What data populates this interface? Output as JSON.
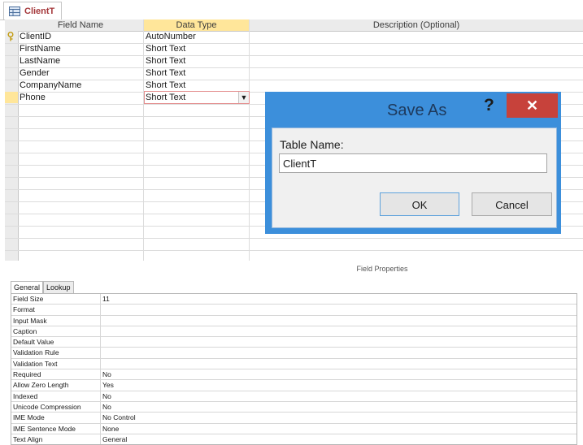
{
  "doc_tab": {
    "label": "ClientT"
  },
  "table": {
    "headers": [
      "Field Name",
      "Data Type",
      "Description (Optional)"
    ],
    "rows": [
      {
        "field": "ClientID",
        "type": "AutoNumber"
      },
      {
        "field": "FirstName",
        "type": "Short Text"
      },
      {
        "field": "LastName",
        "type": "Short Text"
      },
      {
        "field": "Gender",
        "type": "Short Text"
      },
      {
        "field": "CompanyName",
        "type": "Short Text"
      },
      {
        "field": "Phone",
        "type": "Short Text"
      }
    ]
  },
  "field_properties": {
    "title": "Field Properties",
    "tabs": [
      "General",
      "Lookup"
    ],
    "rows": [
      {
        "label": "Field Size",
        "value": "11"
      },
      {
        "label": "Format",
        "value": ""
      },
      {
        "label": "Input Mask",
        "value": ""
      },
      {
        "label": "Caption",
        "value": ""
      },
      {
        "label": "Default Value",
        "value": ""
      },
      {
        "label": "Validation Rule",
        "value": ""
      },
      {
        "label": "Validation Text",
        "value": ""
      },
      {
        "label": "Required",
        "value": "No"
      },
      {
        "label": "Allow Zero Length",
        "value": "Yes"
      },
      {
        "label": "Indexed",
        "value": "No"
      },
      {
        "label": "Unicode Compression",
        "value": "No"
      },
      {
        "label": "IME Mode",
        "value": "No Control"
      },
      {
        "label": "IME Sentence Mode",
        "value": "None"
      },
      {
        "label": "Text Align",
        "value": "General"
      }
    ]
  },
  "dialog": {
    "title": "Save As",
    "help": "?",
    "close": "✕",
    "label": "Table Name:",
    "value": "ClientT",
    "ok": "OK",
    "cancel": "Cancel"
  },
  "colors": {
    "accent": "#3c8fdb",
    "close": "#c7423b",
    "selected_header": "#ffe69a",
    "tab_text": "#a4373a"
  }
}
